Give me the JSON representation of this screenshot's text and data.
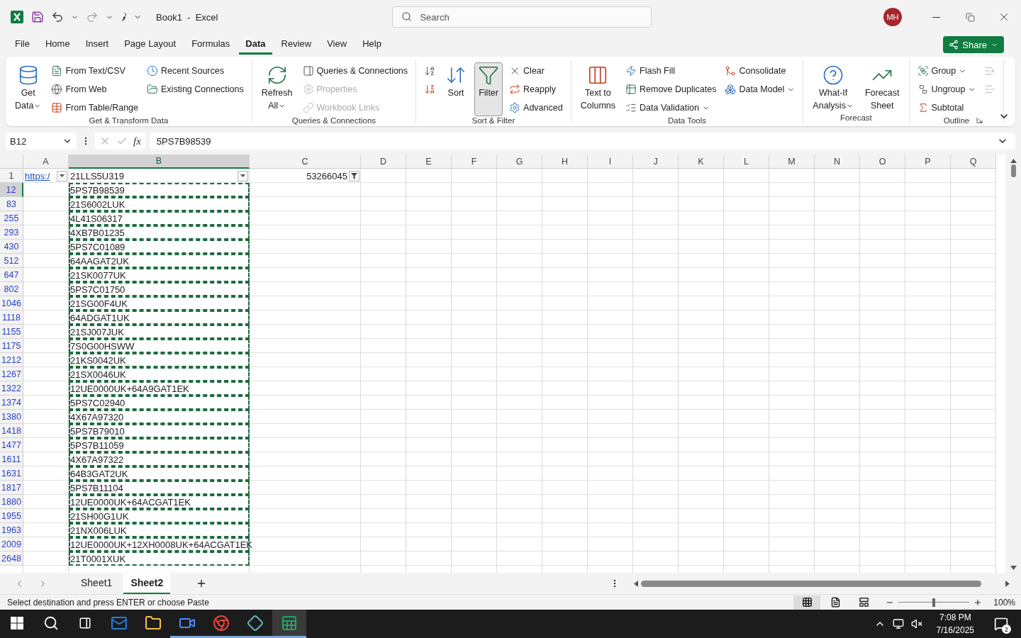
{
  "title_bar": {
    "document_title": "Book1  -  Excel",
    "search_placeholder": "Search",
    "avatar_initials": "MH"
  },
  "menu_tabs": [
    {
      "label": "File",
      "selected": false
    },
    {
      "label": "Home",
      "selected": false
    },
    {
      "label": "Insert",
      "selected": false
    },
    {
      "label": "Page Layout",
      "selected": false
    },
    {
      "label": "Formulas",
      "selected": false
    },
    {
      "label": "Data",
      "selected": true
    },
    {
      "label": "Review",
      "selected": false
    },
    {
      "label": "View",
      "selected": false
    },
    {
      "label": "Help",
      "selected": false
    }
  ],
  "share_button": "Share",
  "ribbon_groups": [
    {
      "name": "Get & Transform Data",
      "items": [
        {
          "kind": "large",
          "lines": [
            "Get",
            "Data"
          ],
          "dropdown": true,
          "disabled": false
        },
        {
          "kind": "small",
          "label": "From Text/CSV",
          "dropdown": false,
          "disabled": false
        },
        {
          "kind": "small",
          "label": "From Web",
          "dropdown": false,
          "disabled": false
        },
        {
          "kind": "small",
          "label": "From Table/Range",
          "dropdown": false,
          "disabled": false
        },
        {
          "kind": "small",
          "label": "Recent Sources",
          "dropdown": false,
          "disabled": false
        },
        {
          "kind": "small",
          "label": "Existing Connections",
          "dropdown": false,
          "disabled": false
        }
      ]
    },
    {
      "name": "Queries & Connections",
      "items": [
        {
          "kind": "large",
          "lines": [
            "Refresh",
            "All"
          ],
          "dropdown": true,
          "disabled": false
        },
        {
          "kind": "small",
          "label": "Queries & Connections",
          "dropdown": false,
          "disabled": false
        },
        {
          "kind": "small",
          "label": "Properties",
          "dropdown": false,
          "disabled": true
        },
        {
          "kind": "small",
          "label": "Workbook Links",
          "dropdown": false,
          "disabled": true
        }
      ]
    },
    {
      "name": "Sort & Filter",
      "items": [
        {
          "kind": "icon",
          "dropdown": false,
          "disabled": false
        },
        {
          "kind": "icon",
          "dropdown": false,
          "disabled": false
        },
        {
          "kind": "large",
          "lines": [
            "Sort"
          ],
          "dropdown": false,
          "disabled": false
        },
        {
          "kind": "toggle",
          "lines": [
            "Filter"
          ],
          "on": true,
          "dropdown": false,
          "disabled": false
        },
        {
          "kind": "small",
          "label": "Clear",
          "dropdown": false,
          "disabled": false
        },
        {
          "kind": "small",
          "label": "Reapply",
          "dropdown": false,
          "disabled": false
        },
        {
          "kind": "small",
          "label": "Advanced",
          "dropdown": false,
          "disabled": false
        }
      ]
    },
    {
      "name": "Data Tools",
      "items": [
        {
          "kind": "large",
          "lines": [
            "Text to",
            "Columns"
          ],
          "dropdown": false,
          "disabled": false
        },
        {
          "kind": "small",
          "label": "Flash Fill",
          "dropdown": false,
          "disabled": false
        },
        {
          "kind": "small",
          "label": "Remove Duplicates",
          "dropdown": false,
          "disabled": false
        },
        {
          "kind": "small",
          "label": "Data Validation",
          "dropdown": true,
          "disabled": false
        },
        {
          "kind": "small",
          "label": "Consolidate",
          "dropdown": false,
          "disabled": false
        },
        {
          "kind": "small",
          "label": "Data Model",
          "dropdown": true,
          "disabled": false
        }
      ]
    },
    {
      "name": "Forecast",
      "items": [
        {
          "kind": "large",
          "lines": [
            "What-If",
            "Analysis"
          ],
          "dropdown": true,
          "disabled": false
        },
        {
          "kind": "large",
          "lines": [
            "Forecast",
            "Sheet"
          ],
          "dropdown": false,
          "disabled": false
        }
      ]
    },
    {
      "name": "Outline",
      "items": [
        {
          "kind": "small",
          "label": "Group",
          "dropdown": true,
          "disabled": false
        },
        {
          "kind": "small",
          "label": "Ungroup",
          "dropdown": true,
          "disabled": false
        },
        {
          "kind": "small",
          "label": "Subtotal",
          "dropdown": false,
          "disabled": false
        },
        {
          "kind": "icon",
          "dropdown": false,
          "disabled": true
        },
        {
          "kind": "icon",
          "dropdown": false,
          "disabled": true
        }
      ]
    }
  ],
  "formula_bar": {
    "name_box": "B12",
    "function_label": "fx",
    "formula": "5PS7B98539"
  },
  "columns": [
    {
      "letter": "A",
      "selected": false
    },
    {
      "letter": "B",
      "selected": true
    },
    {
      "letter": "C",
      "selected": false
    },
    {
      "letter": "D",
      "selected": false
    },
    {
      "letter": "E",
      "selected": false
    },
    {
      "letter": "F",
      "selected": false
    },
    {
      "letter": "G",
      "selected": false
    },
    {
      "letter": "H",
      "selected": false
    },
    {
      "letter": "I",
      "selected": false
    },
    {
      "letter": "J",
      "selected": false
    },
    {
      "letter": "K",
      "selected": false
    },
    {
      "letter": "L",
      "selected": false
    },
    {
      "letter": "M",
      "selected": false
    },
    {
      "letter": "N",
      "selected": false
    },
    {
      "letter": "O",
      "selected": false
    },
    {
      "letter": "P",
      "selected": false
    },
    {
      "letter": "Q",
      "selected": false
    }
  ],
  "header_row": {
    "number": "1",
    "cells": [
      {
        "kind": "link",
        "text": "https:/",
        "filtered": false
      },
      {
        "kind": "text",
        "text": "21LLS5U319",
        "filtered": false
      },
      {
        "kind": "number",
        "text": "53266045",
        "filtered": true
      }
    ]
  },
  "rows": [
    {
      "number": "12",
      "selected": true,
      "value": "5PS7B98539",
      "copied": true
    },
    {
      "number": "83",
      "selected": false,
      "value": "21S6002LUK",
      "copied": true
    },
    {
      "number": "255",
      "selected": false,
      "value": "4L41S06317",
      "copied": true
    },
    {
      "number": "293",
      "selected": false,
      "value": "4XB7B01235",
      "copied": true
    },
    {
      "number": "430",
      "selected": false,
      "value": "5PS7C01089",
      "copied": true
    },
    {
      "number": "512",
      "selected": false,
      "value": "64AAGAT2UK",
      "copied": true
    },
    {
      "number": "647",
      "selected": false,
      "value": "21SK0077UK",
      "copied": true
    },
    {
      "number": "802",
      "selected": false,
      "value": "5PS7C01750",
      "copied": true
    },
    {
      "number": "1046",
      "selected": false,
      "value": "21SG00F4UK",
      "copied": true
    },
    {
      "number": "1118",
      "selected": false,
      "value": "64ADGAT1UK",
      "copied": true
    },
    {
      "number": "1155",
      "selected": false,
      "value": "21SJ007JUK",
      "copied": true
    },
    {
      "number": "1175",
      "selected": false,
      "value": "7S0G00HSWW",
      "copied": true
    },
    {
      "number": "1212",
      "selected": false,
      "value": "21KS0042UK",
      "copied": true
    },
    {
      "number": "1267",
      "selected": false,
      "value": "21SX0046UK",
      "copied": true
    },
    {
      "number": "1322",
      "selected": false,
      "value": "12UE0000UK+64A9GAT1EK",
      "copied": true
    },
    {
      "number": "1374",
      "selected": false,
      "value": "5PS7C02940",
      "copied": true
    },
    {
      "number": "1380",
      "selected": false,
      "value": "4X67A97320",
      "copied": true
    },
    {
      "number": "1418",
      "selected": false,
      "value": "5PS7B79010",
      "copied": true
    },
    {
      "number": "1477",
      "selected": false,
      "value": "5PS7B11059",
      "copied": true
    },
    {
      "number": "1611",
      "selected": false,
      "value": "4X67A97322",
      "copied": true
    },
    {
      "number": "1631",
      "selected": false,
      "value": "64B3GAT2UK",
      "copied": true
    },
    {
      "number": "1817",
      "selected": false,
      "value": "5PS7B11104",
      "copied": true
    },
    {
      "number": "1880",
      "selected": false,
      "value": "12UE0000UK+64ACGAT1EK",
      "copied": true
    },
    {
      "number": "1955",
      "selected": false,
      "value": "21SH00G1UK",
      "copied": true
    },
    {
      "number": "1963",
      "selected": false,
      "value": "21NX006LUK",
      "copied": true
    },
    {
      "number": "2009",
      "selected": false,
      "value": "12UE0000UK+12XH0008UK+64ACGAT1EK",
      "copied": true
    },
    {
      "number": "2648",
      "selected": false,
      "value": "21T0001XUK",
      "copied": true
    }
  ],
  "sheet_tabs": [
    {
      "label": "Sheet1",
      "selected": false
    },
    {
      "label": "Sheet2",
      "selected": true
    }
  ],
  "status_bar": {
    "message": "Select destination and press ENTER or choose Paste",
    "views": [
      {
        "kind": "normal",
        "selected": true
      },
      {
        "kind": "page_layout",
        "selected": false
      },
      {
        "kind": "page_break",
        "selected": false
      }
    ],
    "zoom_slider": {
      "level": 0.5
    },
    "zoom": "100%"
  },
  "taskbar": {
    "apps": [
      {
        "kind": "mail",
        "running": false,
        "selected": false
      },
      {
        "kind": "folder",
        "running": false,
        "selected": false
      },
      {
        "kind": "video",
        "running": true,
        "selected": false
      },
      {
        "kind": "browser",
        "running": true,
        "selected": false
      },
      {
        "kind": "diamond",
        "running": true,
        "selected": false
      },
      {
        "kind": "sheet",
        "running": true,
        "selected": true
      }
    ],
    "time": "7:08 PM",
    "date": "7/16/2025",
    "notification_count": "2"
  }
}
